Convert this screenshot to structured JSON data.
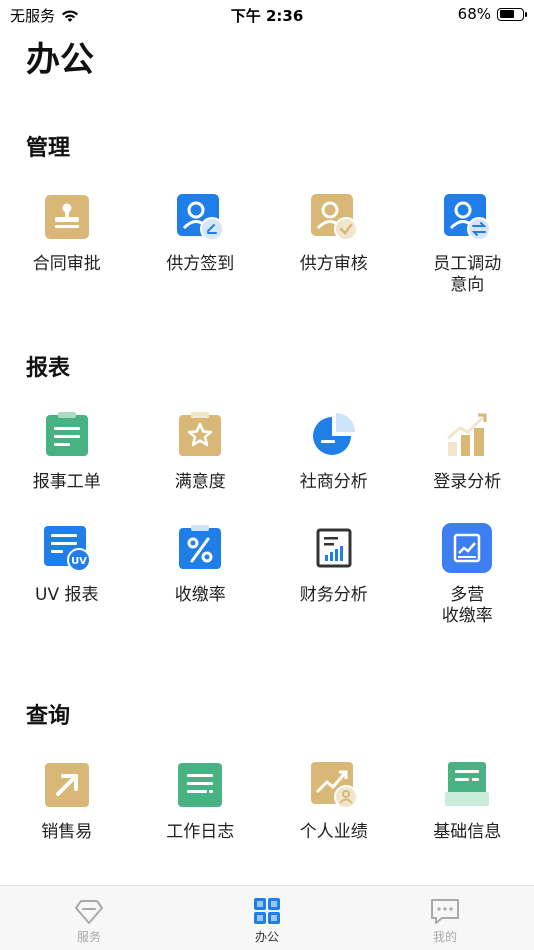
{
  "status": {
    "carrier": "无服务",
    "time": "下午 2:36",
    "battery": "68%",
    "battery_level": 0.68
  },
  "page_title": "办公",
  "sections": [
    {
      "title": "管理",
      "items": [
        {
          "label": "合同审批",
          "icon": "contract-stamp-icon"
        },
        {
          "label": "供方签到",
          "icon": "supplier-signin-icon"
        },
        {
          "label": "供方审核",
          "icon": "supplier-review-icon"
        },
        {
          "label": "员工调动\n意向",
          "icon": "staff-transfer-icon"
        }
      ]
    },
    {
      "title": "报表",
      "items": [
        {
          "label": "报事工单",
          "icon": "work-order-icon"
        },
        {
          "label": "满意度",
          "icon": "satisfaction-icon"
        },
        {
          "label": "社商分析",
          "icon": "pie-chart-icon"
        },
        {
          "label": "登录分析",
          "icon": "bar-trend-icon"
        },
        {
          "label": "UV 报表",
          "icon": "uv-report-icon"
        },
        {
          "label": "收缴率",
          "icon": "percent-icon"
        },
        {
          "label": "财务分析",
          "icon": "finance-chart-icon"
        },
        {
          "label": "多营\n收缴率",
          "icon": "multi-collection-icon"
        }
      ]
    },
    {
      "title": "查询",
      "items": [
        {
          "label": "销售易",
          "icon": "sales-arrow-icon"
        },
        {
          "label": "工作日志",
          "icon": "work-log-icon"
        },
        {
          "label": "个人业绩",
          "icon": "personal-performance-icon"
        },
        {
          "label": "基础信息",
          "icon": "basic-info-icon"
        }
      ]
    }
  ],
  "tabs": [
    {
      "label": "服务",
      "icon": "diamond-icon",
      "active": false
    },
    {
      "label": "办公",
      "icon": "grid-icon",
      "active": true
    },
    {
      "label": "我的",
      "icon": "chat-icon",
      "active": false
    }
  ],
  "colors": {
    "gold": "#d9b877",
    "blue": "#1f7ee8",
    "green": "#48b283",
    "accent_blue": "#3d7ef0"
  }
}
